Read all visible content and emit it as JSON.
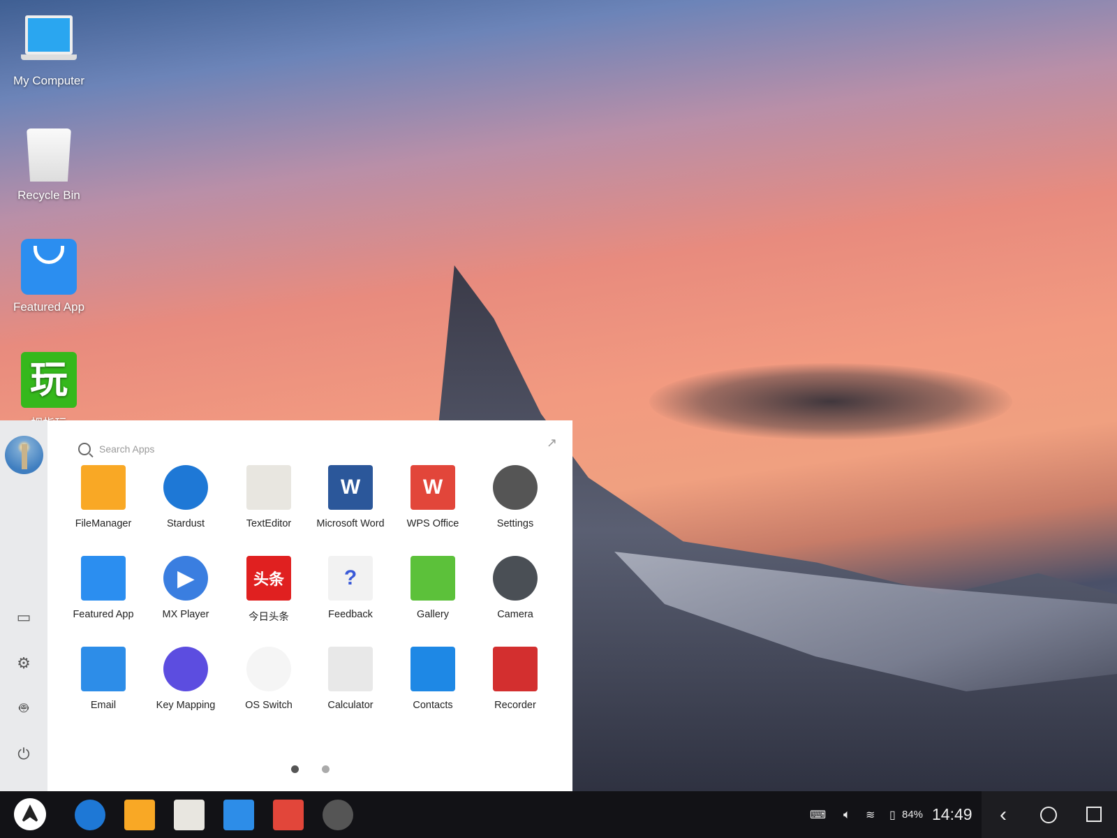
{
  "desktop": {
    "icons": [
      {
        "label": "My Computer",
        "icon": "laptop-icon"
      },
      {
        "label": "Recycle Bin",
        "icon": "trash-icon"
      },
      {
        "label": "Featured App",
        "icon": "shopping-bag-icon"
      },
      {
        "label": "拇指玩",
        "icon": "wan-app-icon",
        "glyph": "玩"
      }
    ]
  },
  "launcher": {
    "search": {
      "placeholder": "Search Apps",
      "value": ""
    },
    "expand_icon": "↗",
    "sidebar": [
      "monitor-icon",
      "gear-icon",
      "android-icon",
      "power-icon"
    ],
    "apps": [
      {
        "label": "FileManager",
        "color": "#f9a825"
      },
      {
        "label": "Stardust",
        "color": "#1e78d6"
      },
      {
        "label": "TextEditor",
        "color": "#e8e6e0"
      },
      {
        "label": "Microsoft Word",
        "color": "#2b579a",
        "glyph": "W"
      },
      {
        "label": "WPS Office",
        "color": "#e2463a",
        "glyph": "W"
      },
      {
        "label": "Settings",
        "color": "#555555"
      },
      {
        "label": "Featured App",
        "color": "#2b8ef0"
      },
      {
        "label": "MX Player",
        "color": "#3a7ee0",
        "glyph": "▶"
      },
      {
        "label": "今日头条",
        "color": "#e02020",
        "glyph": "头条"
      },
      {
        "label": "Feedback",
        "color": "#f2f2f2",
        "glyph": "?"
      },
      {
        "label": "Gallery",
        "color": "#5cc13a"
      },
      {
        "label": "Camera",
        "color": "#4a4f55"
      },
      {
        "label": "Email",
        "color": "#2d8de8"
      },
      {
        "label": "Key Mapping",
        "color": "#5c4de0"
      },
      {
        "label": "OS Switch",
        "color": "#f5f5f5"
      },
      {
        "label": "Calculator",
        "color": "#e8e8e8"
      },
      {
        "label": "Contacts",
        "color": "#1e88e5"
      },
      {
        "label": "Recorder",
        "color": "#d32f2f"
      }
    ],
    "pages": {
      "current": 1,
      "total": 2
    }
  },
  "taskbar": {
    "pinned": [
      "Stardust",
      "FileManager",
      "TextEditor",
      "Email",
      "WPS Office",
      "Settings"
    ],
    "battery": "84%",
    "time": "14:49"
  }
}
